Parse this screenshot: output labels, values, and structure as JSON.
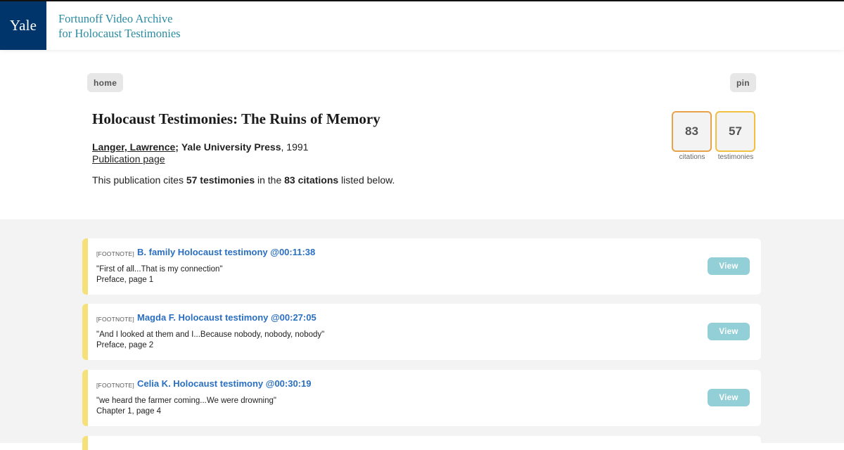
{
  "header": {
    "logo": "Yale",
    "site_title_line1": "Fortunoff Video Archive",
    "site_title_line2": "for Holocaust Testimonies"
  },
  "nav": {
    "home_label": "home",
    "pin_label": "pin"
  },
  "publication": {
    "title": "Holocaust Testimonies: The Ruins of Memory",
    "author": "Langer, Lawrence",
    "separator": ";",
    "press": "Yale University Press",
    "year": ", 1991",
    "publication_link": "Publication page",
    "summary_prefix": "This publication cites ",
    "summary_testimonies": "57 testimonies",
    "summary_middle": " in the ",
    "summary_citations": "83 citations",
    "summary_suffix": " listed below."
  },
  "stats": {
    "citations_value": "83",
    "citations_label": "citations",
    "testimonies_value": "57",
    "testimonies_label": "testimonies"
  },
  "citations": [
    {
      "tag": "[FOOTNOTE]",
      "title": "B. family Holocaust testimony @00:11:38",
      "quote": "\"First of all...That is my connection\"",
      "location": "Preface, page 1",
      "button": "View"
    },
    {
      "tag": "[FOOTNOTE]",
      "title": "Magda F. Holocaust testimony @00:27:05",
      "quote": "\"And I looked at them and I...Because nobody, nobody, nobody\"",
      "location": "Preface, page 2",
      "button": "View"
    },
    {
      "tag": "[FOOTNOTE]",
      "title": "Celia K. Holocaust testimony @00:30:19",
      "quote": "\"we heard the farmer coming...We were drowning\"",
      "location": "Chapter 1, page 4",
      "button": "View"
    }
  ],
  "colors": {
    "yale_blue": "#00356b",
    "site_title": "#2a8ba2",
    "link_blue": "#2a6fc0",
    "view_button": "#93cfd6",
    "card_accent": "#f6e07a",
    "stat_border_citations": "#eaa24a",
    "stat_border_testimonies": "#f0c040"
  }
}
